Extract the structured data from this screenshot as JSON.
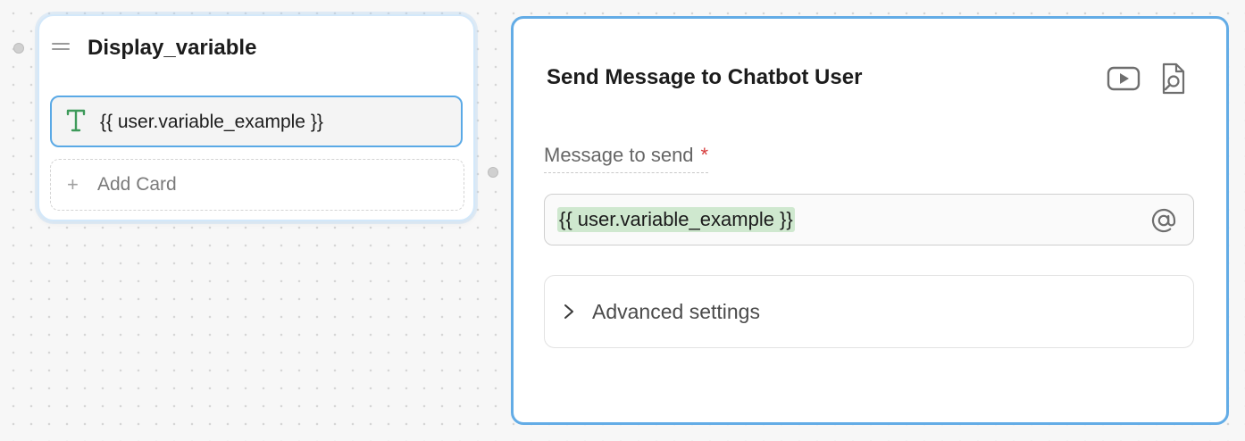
{
  "node": {
    "title": "Display_variable",
    "card_text": "{{ user.variable_example }}",
    "add_card_label": "Add Card",
    "add_card_plus": "+"
  },
  "panel": {
    "title": "Send Message to Chatbot User",
    "field_label": "Message to send",
    "required_mark": "*",
    "message_value": "{{ user.variable_example }}",
    "advanced_label": "Advanced settings"
  },
  "icons": {
    "drag": "drag-handle-icon",
    "text_type": "text-type-icon",
    "video": "video-play-icon",
    "search_doc": "document-search-icon",
    "mention": "at-sign-icon",
    "chevron": "chevron-right-icon"
  },
  "colors": {
    "accent_border": "#63ace6",
    "card_border": "#5aa9e6",
    "variable_highlight": "#cfe8cf",
    "text_icon": "#3e9a5a",
    "required": "#d63a3a"
  }
}
